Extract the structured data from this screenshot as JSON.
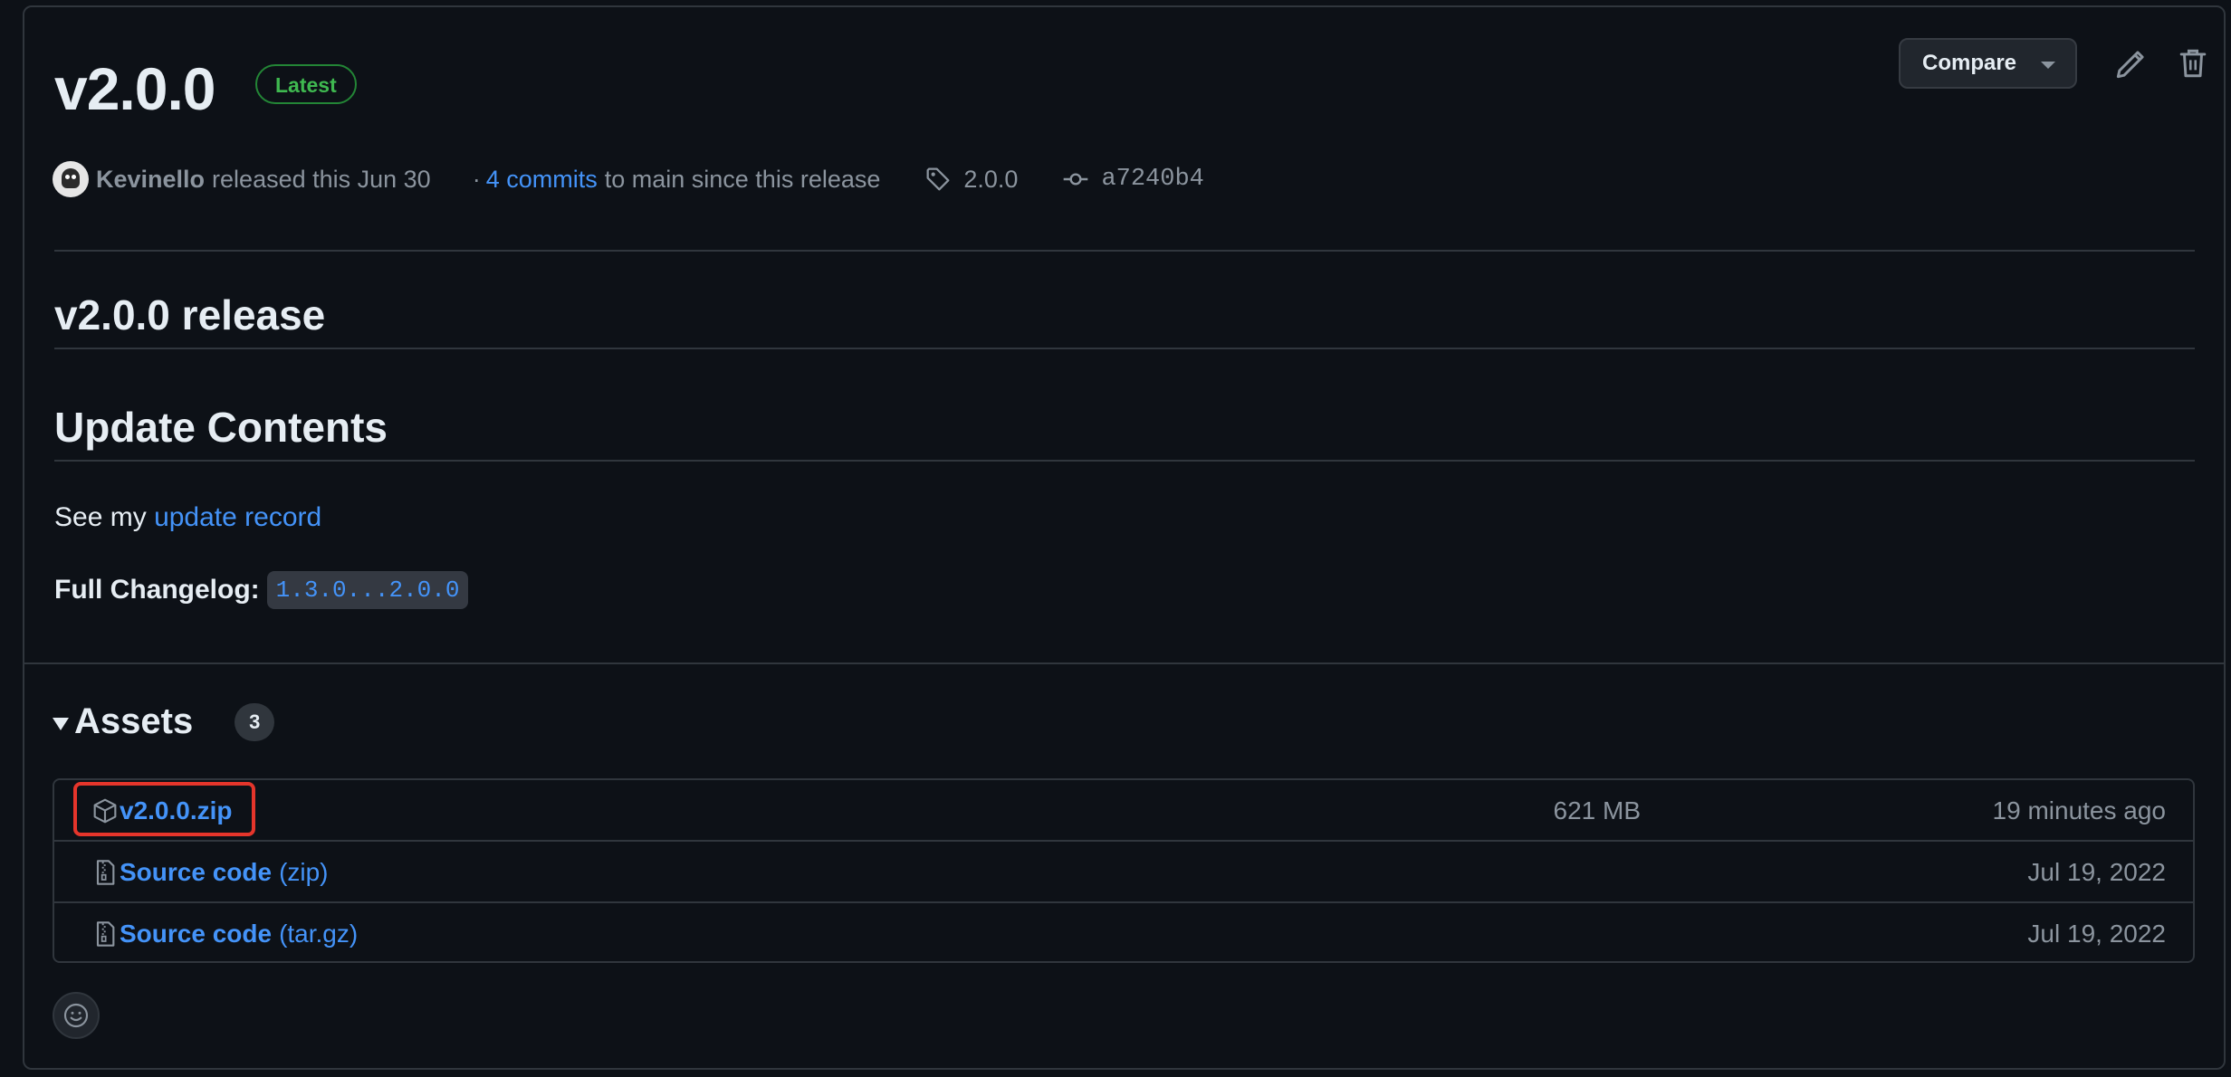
{
  "release": {
    "title": "v2.0.0",
    "badge": "Latest",
    "author": "Kevinello",
    "released_text": "released this Jun 30",
    "commits_prefix": "·",
    "commits_link": "4 commits",
    "commits_suffix": "to main since this release",
    "tag": "2.0.0",
    "commit": "a7240b4"
  },
  "toolbar": {
    "compare_label": "Compare"
  },
  "body": {
    "heading1": "v2.0.0 release",
    "heading2": "Update Contents",
    "see_prefix": "See my",
    "see_link": "update record",
    "changelog_label": "Full Changelog:",
    "changelog_link": "1.3.0...2.0.0"
  },
  "assets": {
    "title": "Assets",
    "count": "3",
    "rows": [
      {
        "name": "v2.0.0.zip",
        "suffix": "",
        "size": "621 MB",
        "date": "19 minutes ago",
        "icon": "package-icon"
      },
      {
        "name": "Source code",
        "suffix": "(zip)",
        "size": "",
        "date": "Jul 19, 2022",
        "icon": "file-zip-icon"
      },
      {
        "name": "Source code",
        "suffix": "(tar.gz)",
        "size": "",
        "date": "Jul 19, 2022",
        "icon": "file-zip-icon"
      }
    ]
  },
  "colors": {
    "background": "#0d1117",
    "border": "#30363d",
    "link": "#4493f8",
    "latest_green": "#3fb950",
    "highlight_red": "#e5352b"
  }
}
